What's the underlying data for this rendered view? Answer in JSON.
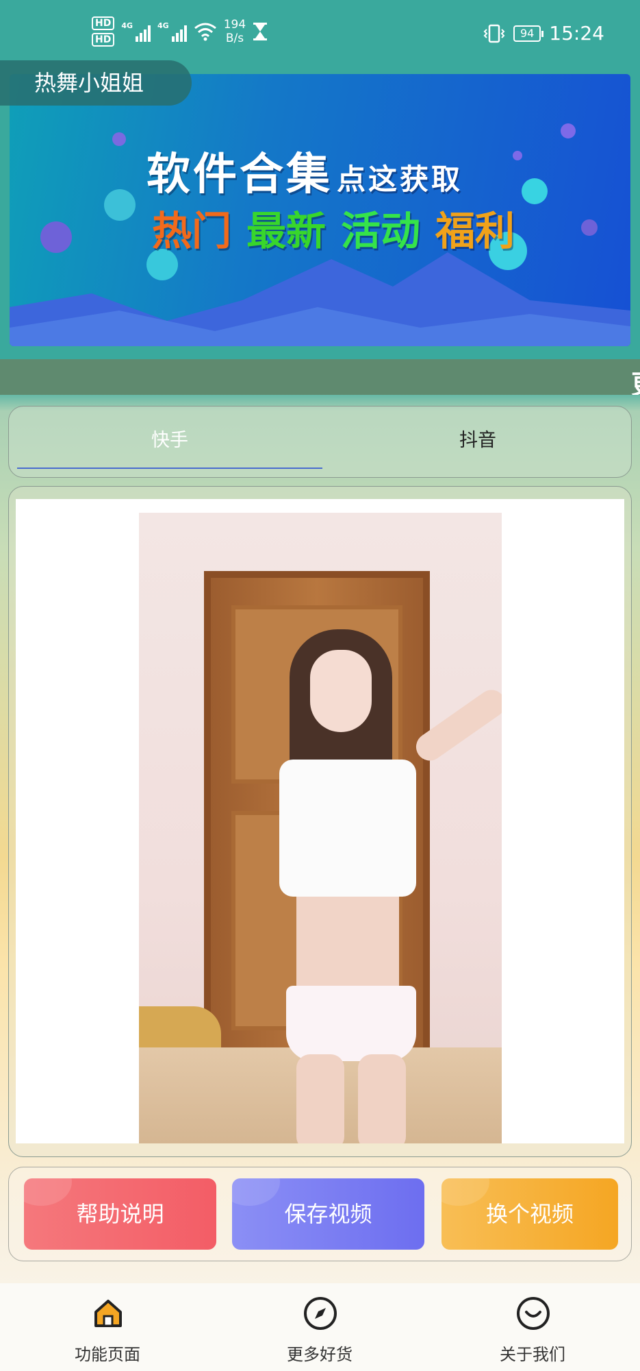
{
  "status_bar": {
    "hd1": "HD",
    "hd2": "HD",
    "sim1_net": "4G",
    "sim2_net": "4G",
    "net_speed_value": "194",
    "net_speed_unit": "B/s",
    "battery": "94",
    "time": "15:24"
  },
  "header": {
    "title": "热舞小姐姐"
  },
  "banner": {
    "main_text": "软件合集",
    "main_suffix": "点这获取",
    "tags": [
      "热门",
      "最新",
      "活动",
      "福利"
    ],
    "tag_colors": [
      "#f26a1b",
      "#38d62c",
      "#35e34a",
      "#f0a21a"
    ]
  },
  "marquee": {
    "text": "更"
  },
  "tabs": {
    "items": [
      {
        "label": "快手",
        "active": true
      },
      {
        "label": "抖音",
        "active": false
      }
    ],
    "active_color": "#4a6ccf"
  },
  "actions": {
    "help_label": "帮助说明",
    "save_label": "保存视频",
    "next_label": "换个视频"
  },
  "bottom_nav": {
    "items": [
      {
        "label": "功能页面",
        "icon": "home-icon",
        "active": true
      },
      {
        "label": "更多好货",
        "icon": "compass-icon",
        "active": false
      },
      {
        "label": "关于我们",
        "icon": "smile-icon",
        "active": false
      }
    ]
  }
}
